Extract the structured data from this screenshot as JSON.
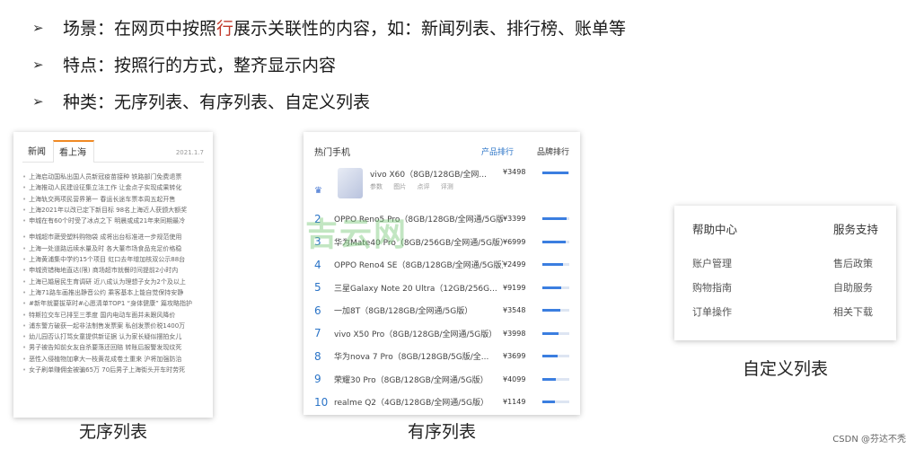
{
  "bullets": [
    {
      "pre": "场景：在网页中按照",
      "hl": "行",
      "post": "展示关联性的内容，如：新闻列表、排行榜、账单等"
    },
    {
      "pre": "特点：按照行的方式，整齐显示内容",
      "hl": "",
      "post": ""
    },
    {
      "pre": "种类：无序列表、有序列表、自定义列表",
      "hl": "",
      "post": ""
    }
  ],
  "panel1": {
    "tabs": [
      "新闻",
      "看上海"
    ],
    "date": "2021.1.7",
    "items": [
      "上海启动国私出国人员新冠疫苗接种 铁路部门免费退票",
      "上海推动人民建设征集立法工作 让金点子实现成果转化",
      "上海轨交两项民营界第一 春运长途车票本周五起开售",
      "上海2021年以改已定下新目标 98名上海近人获颁大额奖",
      "申城在有60个时受了冰点之下 明晨或成21年来同期最冷",
      "申城超市蔬受塑料购物袋 成将出台标准进一步规范使用",
      "上海一处道路远续水量及时 各大董市场食品充足价格稳",
      "上海黄浦集中学约15个项目 虹口去年增加核双公示88台",
      "申城资错梅地直达(限) 商场超市就餐时间提前2小时内",
      "上海已婚居民生育调研 近八成认为理想子女为2个及以上",
      "上海71路车画推出静音公约 乘客基本上能自觉保持安静",
      "#新年就要拔草时#心愿清单TOP1 “身体健康” 篇攻略指护",
      "特斯拉交车已排至三季度 国内电动车面并未跟风降价",
      "浦东警方破获一起非法制售发票案 私创发票价税1400万",
      "幼儿园否认打骂女童提供新证据 认为家长疑似摆拍女儿",
      "男子被告知前女友自杀要落还回赔 转账后报警发现纹死",
      "恶性入侵植物加拿大一枝黄花成卷土重来 沪将加强防治",
      "女子刷单赚佣金被骗65万 70后男子上海街头开车时劳死"
    ],
    "caption": "无序列表"
  },
  "panel2": {
    "title": "热门手机",
    "tab1": "产品排行",
    "tab2": "品牌排行",
    "first": {
      "name": "vivo X60（8GB/128GB/全网...",
      "price": "¥3498",
      "actions": [
        "参数",
        "图片",
        "点评",
        "评测"
      ],
      "level": 0.95
    },
    "rows": [
      {
        "num": "2",
        "name": "OPPO Reno5 Pro（8GB/128GB/全网通/5G版）",
        "price": "¥3399",
        "level": 0.9
      },
      {
        "num": "3",
        "name": "华为Mate40 Pro（8GB/256GB/全网通/5G版）",
        "price": "¥6999",
        "level": 0.85
      },
      {
        "num": "4",
        "name": "OPPO Reno4 SE（8GB/128GB/全网通/5G版）",
        "price": "¥2499",
        "level": 0.75
      },
      {
        "num": "5",
        "name": "三星Galaxy Note 20 Ultra（12GB/256G...",
        "price": "¥9199",
        "level": 0.7
      },
      {
        "num": "6",
        "name": "一加8T（8GB/128GB/全网通/5G版）",
        "price": "¥3548",
        "level": 0.65
      },
      {
        "num": "7",
        "name": "vivo X50 Pro（8GB/128GB/全网通/5G版）",
        "price": "¥3998",
        "level": 0.6
      },
      {
        "num": "8",
        "name": "华为nova 7 Pro（8GB/128GB/5G版/全...",
        "price": "¥3699",
        "level": 0.55
      },
      {
        "num": "9",
        "name": "荣耀30 Pro（8GB/128GB/全网通/5G版）",
        "price": "¥4099",
        "level": 0.5
      },
      {
        "num": "10",
        "name": "realme Q2（4GB/128GB/全网通/5G版）",
        "price": "¥1149",
        "level": 0.45
      }
    ],
    "caption": "有序列表"
  },
  "watermark": "吉云网",
  "panel3": {
    "col1": {
      "head": "帮助中心",
      "items": [
        "账户管理",
        "购物指南",
        "订单操作"
      ]
    },
    "col2": {
      "head": "服务支持",
      "items": [
        "售后政策",
        "自助服务",
        "相关下载"
      ]
    },
    "caption": "自定义列表"
  },
  "credit": "CSDN @芬达不秃"
}
